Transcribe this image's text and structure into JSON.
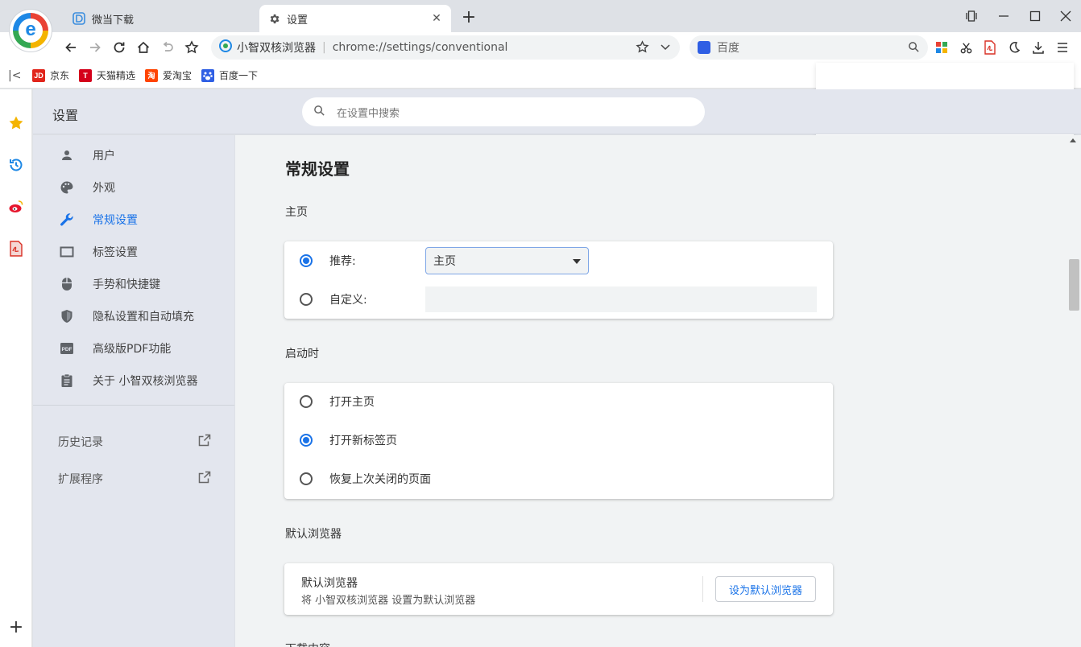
{
  "tabs": [
    {
      "title": "微当下载",
      "icon": "weidown-favicon"
    },
    {
      "title": "设置",
      "icon": "gear-icon"
    }
  ],
  "toolbar": {
    "site_name": "小智双核浏览器",
    "url": "chrome://settings/conventional",
    "search_engine_label": "百度"
  },
  "bookmarks": [
    {
      "label": "京东",
      "icon_text": "JD",
      "color": "#e1251b"
    },
    {
      "label": "天猫精选",
      "icon_text": "T",
      "color": "#d4001b"
    },
    {
      "label": "爱淘宝",
      "icon_text": "淘",
      "color": "#ff4400"
    },
    {
      "label": "百度一下",
      "icon_text": "",
      "color": "#2f5fe4"
    }
  ],
  "settings": {
    "title": "设置",
    "search_placeholder": "在设置中搜索",
    "nav": [
      {
        "label": "用户",
        "icon": "person-icon",
        "active": false
      },
      {
        "label": "外观",
        "icon": "palette-icon",
        "active": false
      },
      {
        "label": "常规设置",
        "icon": "wrench-icon",
        "active": true
      },
      {
        "label": "标签设置",
        "icon": "tab-icon",
        "active": false
      },
      {
        "label": "手势和快捷键",
        "icon": "mouse-icon",
        "active": false
      },
      {
        "label": "隐私设置和自动填充",
        "icon": "shield-icon",
        "active": false
      },
      {
        "label": "高级版PDF功能",
        "icon": "pdf-icon",
        "active": false
      },
      {
        "label": "关于 小智双核浏览器",
        "icon": "clipboard-icon",
        "active": false
      }
    ],
    "links": [
      {
        "label": "历史记录",
        "icon": "external-link-icon"
      },
      {
        "label": "扩展程序",
        "icon": "external-link-icon"
      }
    ]
  },
  "content": {
    "section_title": "常规设置",
    "homepage": {
      "label": "主页",
      "recommended_label": "推荐:",
      "recommended_value": "主页",
      "custom_label": "自定义:",
      "custom_value": ""
    },
    "startup": {
      "label": "启动时",
      "options": [
        {
          "label": "打开主页",
          "checked": false
        },
        {
          "label": "打开新标签页",
          "checked": true
        },
        {
          "label": "恢复上次关闭的页面",
          "checked": false
        }
      ]
    },
    "default_browser": {
      "label": "默认浏览器",
      "title": "默认浏览器",
      "description": "将 小智双核浏览器 设置为默认浏览器",
      "button": "设为默认浏览器"
    },
    "downloads_label": "下载内容"
  },
  "colors": {
    "accent": "#1a73e8",
    "nav_bg": "#e3e6ee",
    "content_bg": "#f1f3f4"
  }
}
